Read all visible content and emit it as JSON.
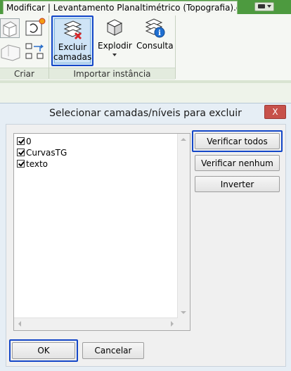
{
  "ribbon": {
    "active_tab": "Modificar | Levantamento Planaltimétrico (Topografia).dwg",
    "panels": {
      "criar_label": "Criar",
      "importar_label": "Importar instância"
    },
    "buttons": {
      "excluir": "Excluir camadas",
      "explodir": "Explodir",
      "consulta": "Consulta"
    }
  },
  "dialog": {
    "title": "Selecionar camadas/níveis para excluir",
    "close_label": "X",
    "layers": [
      {
        "name": "0",
        "checked": true
      },
      {
        "name": "CurvasTG",
        "checked": true
      },
      {
        "name": "texto",
        "checked": true
      }
    ],
    "buttons": {
      "check_all": "Verificar todos",
      "check_none": "Verificar nenhum",
      "invert": "Inverter",
      "ok": "OK",
      "cancel": "Cancelar"
    }
  },
  "colors": {
    "ribbon_tab_bar": "#4d9a3f",
    "highlight": "#1447c8",
    "close_button": "#c7514a"
  }
}
